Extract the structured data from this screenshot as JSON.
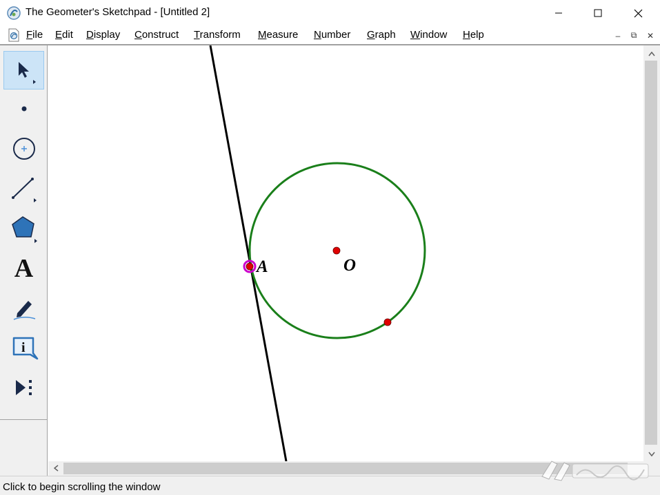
{
  "window": {
    "title": "The Geometer's Sketchpad - [Untitled 2]",
    "controls": [
      "minimize",
      "maximize",
      "close"
    ]
  },
  "menubar": {
    "items": [
      {
        "label": "File",
        "accel": "F",
        "rest": "ile"
      },
      {
        "label": "Edit",
        "accel": "E",
        "rest": "dit"
      },
      {
        "label": "Display",
        "accel": "D",
        "rest": "isplay"
      },
      {
        "label": "Construct",
        "accel": "C",
        "rest": "onstruct"
      },
      {
        "label": "Transform",
        "accel": "T",
        "rest": "ransform"
      },
      {
        "label": "Measure",
        "accel": "M",
        "rest": "easure"
      },
      {
        "label": "Number",
        "accel": "N",
        "rest": "umber"
      },
      {
        "label": "Graph",
        "accel": "G",
        "rest": "raph"
      },
      {
        "label": "Window",
        "accel": "W",
        "rest": "indow"
      },
      {
        "label": "Help",
        "accel": "H",
        "rest": "elp"
      }
    ],
    "mdi_controls": {
      "minimize": "‒",
      "restore": "⧉",
      "close": "✕"
    }
  },
  "toolbox": {
    "tools": [
      {
        "name": "arrow-tool",
        "icon": "arrow-select-icon",
        "selected": true
      },
      {
        "name": "point-tool",
        "icon": "point-icon",
        "selected": false
      },
      {
        "name": "compass-tool",
        "icon": "circle-compass-icon",
        "selected": false
      },
      {
        "name": "straightedge-tool",
        "icon": "line-segment-icon",
        "selected": false
      },
      {
        "name": "polygon-tool",
        "icon": "polygon-icon",
        "selected": false
      },
      {
        "name": "text-tool",
        "icon": "text-A-icon",
        "label": "A",
        "selected": false
      },
      {
        "name": "marker-tool",
        "icon": "marker-pen-icon",
        "selected": false
      },
      {
        "name": "information-tool",
        "icon": "info-icon",
        "label": "i",
        "selected": false
      },
      {
        "name": "custom-tool",
        "icon": "custom-tool-icon",
        "selected": false
      }
    ]
  },
  "sketch": {
    "labels": {
      "point_A": "A",
      "center": "O"
    },
    "colors": {
      "circle": "#1a7f1a",
      "line": "#000000",
      "point": "#e00000",
      "selection": "#cc00cc"
    }
  },
  "statusbar": {
    "text": "Click to begin scrolling the window"
  },
  "colors": {
    "chrome": "#f0f0f0",
    "selected_tool": "#cce4f7",
    "scroll_thumb": "#cdcdcd"
  }
}
